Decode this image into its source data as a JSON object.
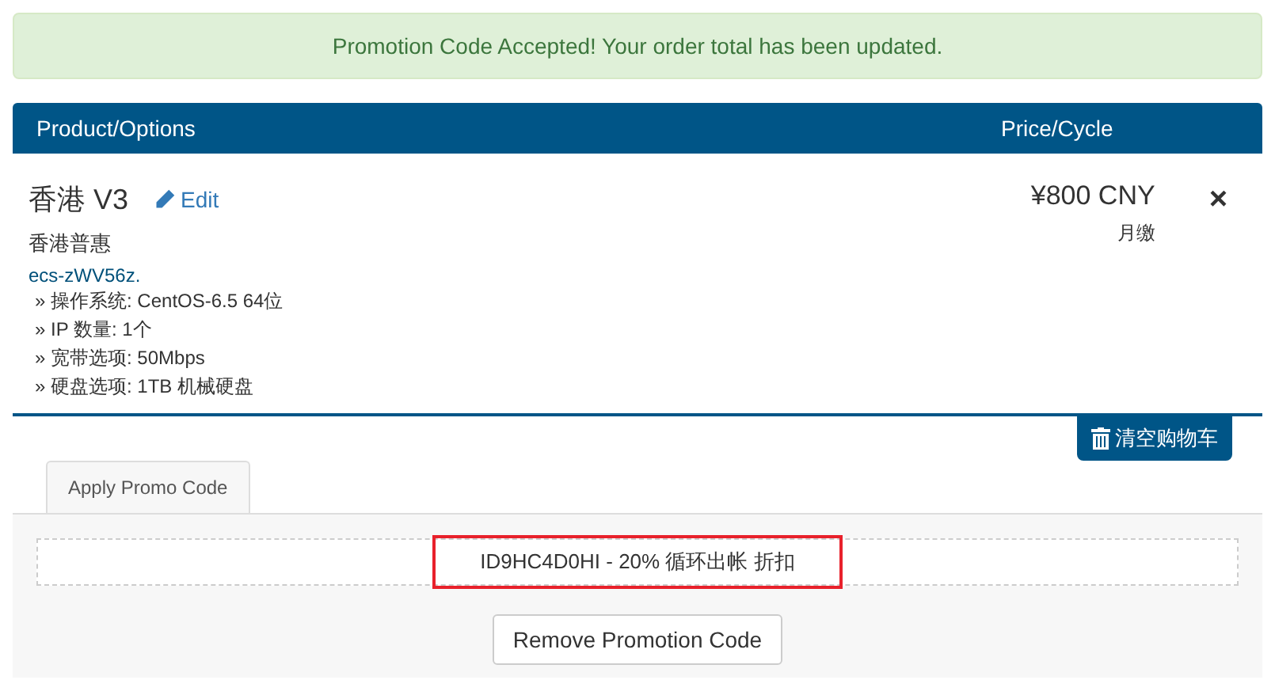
{
  "alert": {
    "message": "Promotion Code Accepted! Your order total has been updated."
  },
  "cart": {
    "columns": [
      "Product/Options",
      "Price/Cycle"
    ],
    "item": {
      "name": "香港 V3",
      "edit_label": "Edit",
      "group": "香港普惠",
      "hostname": "ecs-zWV56z.",
      "options": [
        "» 操作系统: CentOS-6.5 64位",
        "» IP 数量: 1个",
        "» 宽带选项: 50Mbps",
        "» 硬盘选项: 1TB 机械硬盘"
      ],
      "price": "¥800 CNY",
      "cycle": "月缴",
      "remove": "×"
    },
    "clear_button": "清空购物车"
  },
  "promo": {
    "tabs": [
      {
        "label": "Apply Promo Code",
        "selected": true
      }
    ],
    "applied": "ID9HC4D0HI - 20% 循环出帐 折扣",
    "remove_button": "Remove Promotion Code"
  }
}
